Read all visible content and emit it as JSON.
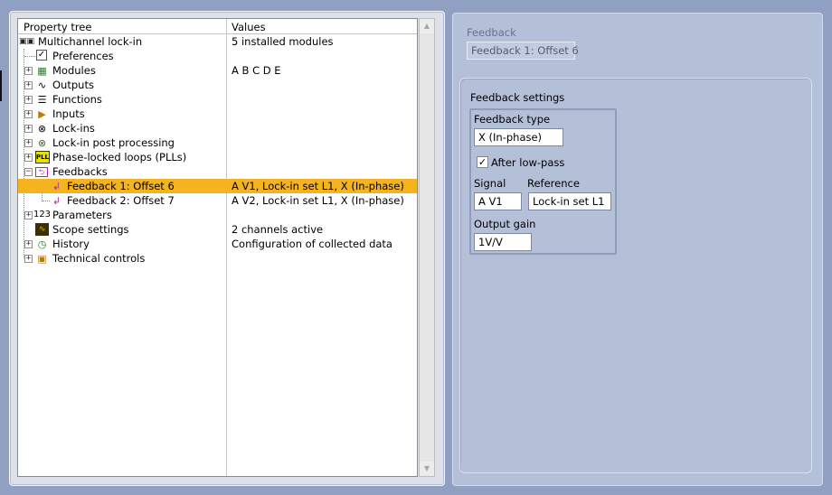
{
  "tree": {
    "headers": {
      "property": "Property tree",
      "values": "Values"
    },
    "rows": [
      {
        "label": "Multichannel lock-in",
        "value": "5 installed modules",
        "icon": "module-rack-icon"
      },
      {
        "label": "Preferences",
        "value": "",
        "icon": "checkbox-icon"
      },
      {
        "label": "Modules",
        "value": "A B C D E",
        "icon": "circuit-board-icon"
      },
      {
        "label": "Outputs",
        "value": "",
        "icon": "wave-output-icon"
      },
      {
        "label": "Functions",
        "value": "",
        "icon": "list-icon"
      },
      {
        "label": "Inputs",
        "value": "",
        "icon": "amplifier-icon"
      },
      {
        "label": "Lock-ins",
        "value": "",
        "icon": "mixer-icon"
      },
      {
        "label": "Lock-in post processing",
        "value": "",
        "icon": "mixer-processing-icon"
      },
      {
        "label": "Phase-locked loops (PLLs)",
        "value": "",
        "icon": "pll-icon"
      },
      {
        "label": "Feedbacks",
        "value": "",
        "icon": "feedback-icon"
      },
      {
        "label": "Feedback 1: Offset 6",
        "value": "A V1, Lock-in set L1, X (In-phase)",
        "icon": "feedback-arrow-icon"
      },
      {
        "label": "Feedback 2: Offset 7",
        "value": "A V2, Lock-in set L1, X (In-phase)",
        "icon": "feedback-arrow-icon"
      },
      {
        "label": "Parameters",
        "value": "",
        "icon": "numeric-123-icon"
      },
      {
        "label": "Scope settings",
        "value": "2 channels active",
        "icon": "scope-icon"
      },
      {
        "label": "History",
        "value": "Configuration of collected data",
        "icon": "clock-icon"
      },
      {
        "label": "Technical controls",
        "value": "",
        "icon": "chip-icon"
      }
    ],
    "selected_row": 10
  },
  "feedback": {
    "caption": "Feedback",
    "name": "Feedback 1: Offset 6",
    "settings_title": "Feedback settings",
    "type_label": "Feedback type",
    "type_value": "X (In-phase)",
    "after_lowpass_label": "After low-pass",
    "after_lowpass_checked": true,
    "signal_label": "Signal",
    "signal_value": "A V1",
    "reference_label": "Reference",
    "reference_value": "Lock-in set L1",
    "gain_label": "Output gain",
    "gain_value": "1V/V"
  },
  "colors": {
    "background": "#8fa0c2",
    "panel": "#b4bfd8",
    "selection": "#f5b31f"
  }
}
